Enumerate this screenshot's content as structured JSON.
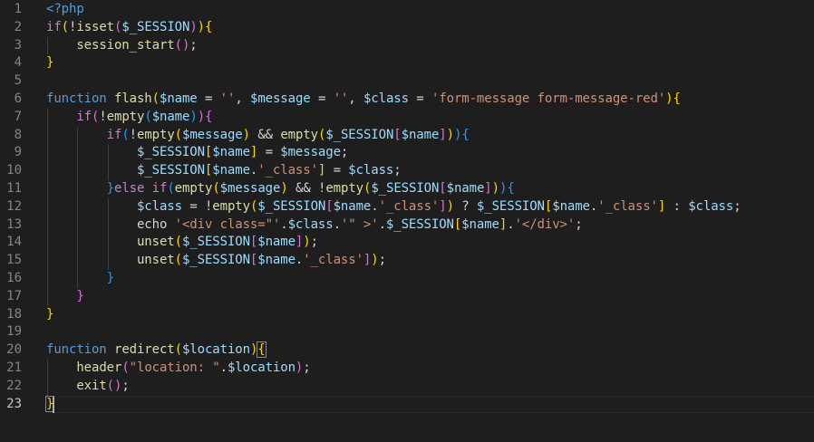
{
  "editor": {
    "line_numbers": [
      "1",
      "2",
      "3",
      "4",
      "5",
      "6",
      "7",
      "8",
      "9",
      "10",
      "11",
      "12",
      "13",
      "14",
      "15",
      "16",
      "17",
      "18",
      "19",
      "20",
      "21",
      "22",
      "23"
    ],
    "active_line": "23",
    "lines": [
      [
        {
          "t": "<?php",
          "c": "k"
        }
      ],
      [
        {
          "t": "if",
          "c": "c"
        },
        {
          "t": "(",
          "c": "b1"
        },
        {
          "t": "!",
          "c": "p"
        },
        {
          "t": "isset",
          "c": "f"
        },
        {
          "t": "(",
          "c": "b2"
        },
        {
          "t": "$_SESSION",
          "c": "v"
        },
        {
          "t": ")",
          "c": "b2"
        },
        {
          "t": ")",
          "c": "b1"
        },
        {
          "t": "{",
          "c": "b1"
        }
      ],
      [
        {
          "t": "    ",
          "c": "p"
        },
        {
          "t": "session_start",
          "c": "f"
        },
        {
          "t": "()",
          "c": "b2"
        },
        {
          "t": ";",
          "c": "p"
        }
      ],
      [
        {
          "t": "}",
          "c": "b1"
        }
      ],
      [],
      [
        {
          "t": "function",
          "c": "k"
        },
        {
          "t": " ",
          "c": "p"
        },
        {
          "t": "flash",
          "c": "f"
        },
        {
          "t": "(",
          "c": "b1"
        },
        {
          "t": "$name",
          "c": "v"
        },
        {
          "t": " = ",
          "c": "p"
        },
        {
          "t": "''",
          "c": "s"
        },
        {
          "t": ", ",
          "c": "p"
        },
        {
          "t": "$message",
          "c": "v"
        },
        {
          "t": " = ",
          "c": "p"
        },
        {
          "t": "''",
          "c": "s"
        },
        {
          "t": ", ",
          "c": "p"
        },
        {
          "t": "$class",
          "c": "v"
        },
        {
          "t": " = ",
          "c": "p"
        },
        {
          "t": "'form-message form-message-red'",
          "c": "s"
        },
        {
          "t": ")",
          "c": "b1"
        },
        {
          "t": "{",
          "c": "b1"
        }
      ],
      [
        {
          "t": "    ",
          "c": "p"
        },
        {
          "t": "if",
          "c": "c"
        },
        {
          "t": "(",
          "c": "b2"
        },
        {
          "t": "!",
          "c": "p"
        },
        {
          "t": "empty",
          "c": "f"
        },
        {
          "t": "(",
          "c": "b3"
        },
        {
          "t": "$name",
          "c": "v"
        },
        {
          "t": ")",
          "c": "b3"
        },
        {
          "t": ")",
          "c": "b2"
        },
        {
          "t": "{",
          "c": "b2"
        }
      ],
      [
        {
          "t": "        ",
          "c": "p"
        },
        {
          "t": "if",
          "c": "c"
        },
        {
          "t": "(",
          "c": "b3"
        },
        {
          "t": "!",
          "c": "p"
        },
        {
          "t": "empty",
          "c": "f"
        },
        {
          "t": "(",
          "c": "b1"
        },
        {
          "t": "$message",
          "c": "v"
        },
        {
          "t": ")",
          "c": "b1"
        },
        {
          "t": " && ",
          "c": "p"
        },
        {
          "t": "empty",
          "c": "f"
        },
        {
          "t": "(",
          "c": "b1"
        },
        {
          "t": "$_SESSION",
          "c": "v"
        },
        {
          "t": "[",
          "c": "b2"
        },
        {
          "t": "$name",
          "c": "v"
        },
        {
          "t": "]",
          "c": "b2"
        },
        {
          "t": ")",
          "c": "b1"
        },
        {
          "t": ")",
          "c": "b3"
        },
        {
          "t": "{",
          "c": "b3"
        }
      ],
      [
        {
          "t": "            ",
          "c": "p"
        },
        {
          "t": "$_SESSION",
          "c": "v"
        },
        {
          "t": "[",
          "c": "b1"
        },
        {
          "t": "$name",
          "c": "v"
        },
        {
          "t": "]",
          "c": "b1"
        },
        {
          "t": " = ",
          "c": "p"
        },
        {
          "t": "$message",
          "c": "v"
        },
        {
          "t": ";",
          "c": "p"
        }
      ],
      [
        {
          "t": "            ",
          "c": "p"
        },
        {
          "t": "$_SESSION",
          "c": "v"
        },
        {
          "t": "[",
          "c": "b1"
        },
        {
          "t": "$name",
          "c": "v"
        },
        {
          "t": ".",
          "c": "p"
        },
        {
          "t": "'_class'",
          "c": "s"
        },
        {
          "t": "]",
          "c": "b1"
        },
        {
          "t": " = ",
          "c": "p"
        },
        {
          "t": "$class",
          "c": "v"
        },
        {
          "t": ";",
          "c": "p"
        }
      ],
      [
        {
          "t": "        ",
          "c": "p"
        },
        {
          "t": "}",
          "c": "b3"
        },
        {
          "t": "else",
          "c": "c"
        },
        {
          "t": " ",
          "c": "p"
        },
        {
          "t": "if",
          "c": "c"
        },
        {
          "t": "(",
          "c": "b3"
        },
        {
          "t": "empty",
          "c": "f"
        },
        {
          "t": "(",
          "c": "b1"
        },
        {
          "t": "$message",
          "c": "v"
        },
        {
          "t": ")",
          "c": "b1"
        },
        {
          "t": " && ",
          "c": "p"
        },
        {
          "t": "!",
          "c": "p"
        },
        {
          "t": "empty",
          "c": "f"
        },
        {
          "t": "(",
          "c": "b1"
        },
        {
          "t": "$_SESSION",
          "c": "v"
        },
        {
          "t": "[",
          "c": "b2"
        },
        {
          "t": "$name",
          "c": "v"
        },
        {
          "t": "]",
          "c": "b2"
        },
        {
          "t": ")",
          "c": "b1"
        },
        {
          "t": ")",
          "c": "b3"
        },
        {
          "t": "{",
          "c": "b3"
        }
      ],
      [
        {
          "t": "            ",
          "c": "p"
        },
        {
          "t": "$class",
          "c": "v"
        },
        {
          "t": " = ",
          "c": "p"
        },
        {
          "t": "!",
          "c": "p"
        },
        {
          "t": "empty",
          "c": "f"
        },
        {
          "t": "(",
          "c": "b1"
        },
        {
          "t": "$_SESSION",
          "c": "v"
        },
        {
          "t": "[",
          "c": "b2"
        },
        {
          "t": "$name",
          "c": "v"
        },
        {
          "t": ".",
          "c": "p"
        },
        {
          "t": "'_class'",
          "c": "s"
        },
        {
          "t": "]",
          "c": "b2"
        },
        {
          "t": ")",
          "c": "b1"
        },
        {
          "t": " ? ",
          "c": "p"
        },
        {
          "t": "$_SESSION",
          "c": "v"
        },
        {
          "t": "[",
          "c": "b1"
        },
        {
          "t": "$name",
          "c": "v"
        },
        {
          "t": ".",
          "c": "p"
        },
        {
          "t": "'_class'",
          "c": "s"
        },
        {
          "t": "]",
          "c": "b1"
        },
        {
          "t": " : ",
          "c": "p"
        },
        {
          "t": "$class",
          "c": "v"
        },
        {
          "t": ";",
          "c": "p"
        }
      ],
      [
        {
          "t": "            ",
          "c": "p"
        },
        {
          "t": "echo",
          "c": "p"
        },
        {
          "t": " ",
          "c": "p"
        },
        {
          "t": "'<div class=\"'",
          "c": "s"
        },
        {
          "t": ".",
          "c": "p"
        },
        {
          "t": "$class",
          "c": "v"
        },
        {
          "t": ".",
          "c": "p"
        },
        {
          "t": "'\" >'",
          "c": "s"
        },
        {
          "t": ".",
          "c": "p"
        },
        {
          "t": "$_SESSION",
          "c": "v"
        },
        {
          "t": "[",
          "c": "b1"
        },
        {
          "t": "$name",
          "c": "v"
        },
        {
          "t": "]",
          "c": "b1"
        },
        {
          "t": ".",
          "c": "p"
        },
        {
          "t": "'</div>'",
          "c": "s"
        },
        {
          "t": ";",
          "c": "p"
        }
      ],
      [
        {
          "t": "            ",
          "c": "p"
        },
        {
          "t": "unset",
          "c": "f"
        },
        {
          "t": "(",
          "c": "b1"
        },
        {
          "t": "$_SESSION",
          "c": "v"
        },
        {
          "t": "[",
          "c": "b2"
        },
        {
          "t": "$name",
          "c": "v"
        },
        {
          "t": "]",
          "c": "b2"
        },
        {
          "t": ")",
          "c": "b1"
        },
        {
          "t": ";",
          "c": "p"
        }
      ],
      [
        {
          "t": "            ",
          "c": "p"
        },
        {
          "t": "unset",
          "c": "f"
        },
        {
          "t": "(",
          "c": "b1"
        },
        {
          "t": "$_SESSION",
          "c": "v"
        },
        {
          "t": "[",
          "c": "b2"
        },
        {
          "t": "$name",
          "c": "v"
        },
        {
          "t": ".",
          "c": "p"
        },
        {
          "t": "'_class'",
          "c": "s"
        },
        {
          "t": "]",
          "c": "b2"
        },
        {
          "t": ")",
          "c": "b1"
        },
        {
          "t": ";",
          "c": "p"
        }
      ],
      [
        {
          "t": "        ",
          "c": "p"
        },
        {
          "t": "}",
          "c": "b3"
        }
      ],
      [
        {
          "t": "    ",
          "c": "p"
        },
        {
          "t": "}",
          "c": "b2"
        }
      ],
      [
        {
          "t": "}",
          "c": "b1"
        }
      ],
      [],
      [
        {
          "t": "function",
          "c": "k"
        },
        {
          "t": " ",
          "c": "p"
        },
        {
          "t": "redirect",
          "c": "f"
        },
        {
          "t": "(",
          "c": "b1"
        },
        {
          "t": "$location",
          "c": "v"
        },
        {
          "t": ")",
          "c": "b1"
        },
        {
          "t": "{",
          "c": "b1 hl"
        }
      ],
      [
        {
          "t": "    ",
          "c": "p"
        },
        {
          "t": "header",
          "c": "f"
        },
        {
          "t": "(",
          "c": "b2"
        },
        {
          "t": "\"location: \"",
          "c": "s"
        },
        {
          "t": ".",
          "c": "p"
        },
        {
          "t": "$location",
          "c": "v"
        },
        {
          "t": ")",
          "c": "b2"
        },
        {
          "t": ";",
          "c": "p"
        }
      ],
      [
        {
          "t": "    ",
          "c": "p"
        },
        {
          "t": "exit",
          "c": "f"
        },
        {
          "t": "()",
          "c": "b2"
        },
        {
          "t": ";",
          "c": "p"
        }
      ],
      [
        {
          "t": "}",
          "c": "b1 hl"
        }
      ]
    ]
  }
}
